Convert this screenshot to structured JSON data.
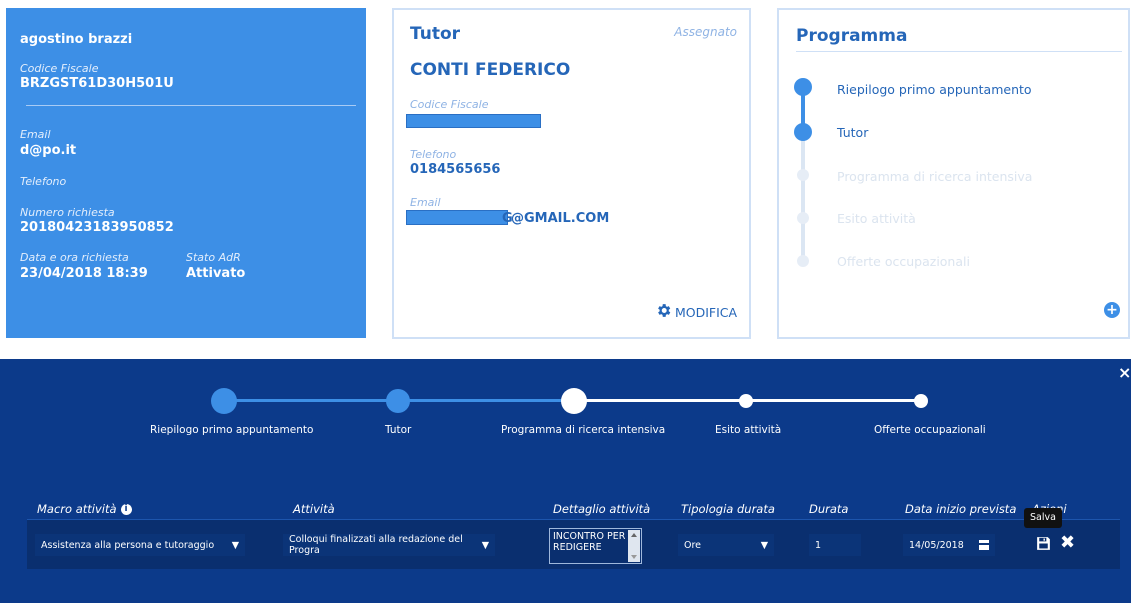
{
  "user_card": {
    "name": "agostino brazzi",
    "codice_fiscale_label": "Codice Fiscale",
    "codice_fiscale": "BRZGST61D30H501U",
    "email_label": "Email",
    "email": "d@po.it",
    "telefono_label": "Telefono",
    "numero_richiesta_label": "Numero richiesta",
    "numero_richiesta": "20180423183950852",
    "data_ora_label": "Data e ora richiesta",
    "data_ora": "23/04/2018 18:39",
    "stato_label": "Stato AdR",
    "stato": "Attivato"
  },
  "tutor_card": {
    "title": "Tutor",
    "status": "Assegnato",
    "name": "CONTI FEDERICO",
    "codice_fiscale_label": "Codice Fiscale",
    "telefono_label": "Telefono",
    "telefono": "0184565656",
    "email_label": "Email",
    "email_visible": "@GMAIL.COM",
    "email_partial_char": "G",
    "modifica_label": "MODIFICA"
  },
  "programma_card": {
    "title": "Programma",
    "steps": [
      {
        "label": "Riepilogo primo appuntamento",
        "active": true
      },
      {
        "label": "Tutor",
        "active": true
      },
      {
        "label": "Programma di ricerca intensiva",
        "active": false
      },
      {
        "label": "Esito attività",
        "active": false
      },
      {
        "label": "Offerte occupazionali",
        "active": false
      }
    ]
  },
  "wizard": {
    "steps": [
      {
        "label": "Riepilogo primo appuntamento",
        "state": "done"
      },
      {
        "label": "Tutor",
        "state": "done"
      },
      {
        "label": "Programma di ricerca intensiva",
        "state": "current"
      },
      {
        "label": "Esito attività",
        "state": "todo"
      },
      {
        "label": "Offerte occupazionali",
        "state": "todo"
      }
    ],
    "close_glyph": "×"
  },
  "table": {
    "headers": {
      "macro": "Macro attività",
      "attivita": "Attività",
      "dettaglio": "Dettaglio attività",
      "tipologia": "Tipologia durata",
      "durata": "Durata",
      "data_inizio": "Data inizio prevista",
      "azioni": "Azioni"
    },
    "row": {
      "macro": "Assistenza alla persona e tutoraggio",
      "attivita": "Colloqui finalizzati alla redazione del Progra",
      "dettaglio_line1": "INCONTRO PER",
      "dettaglio_line2": "REDIGERE",
      "tipologia": "Ore",
      "durata": "1",
      "data_inizio": "14/05/2018"
    },
    "tooltip": "Salva"
  },
  "colors": {
    "primary_blue": "#3d8fe6",
    "dark_navy": "#0c3a8a",
    "title_blue": "#2566b8"
  }
}
